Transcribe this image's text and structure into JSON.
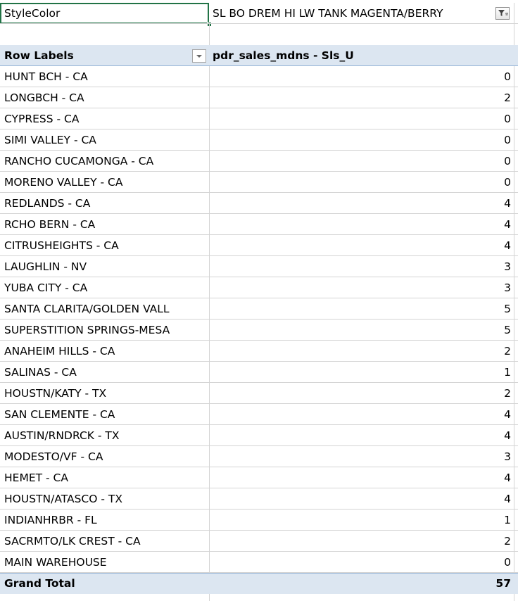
{
  "filter": {
    "label": "StyleColor",
    "value": "SL BO DREM HI LW TANK MAGENTA/BERRY",
    "filter_icon": "filter-active-icon"
  },
  "header": {
    "row_labels": "Row Labels",
    "value_field": "pdr_sales_mdns - Sls_U",
    "dropdown_icon": "dropdown-arrow-icon"
  },
  "rows": [
    {
      "label": "HUNT BCH - CA",
      "value": "0"
    },
    {
      "label": "LONGBCH - CA",
      "value": "2"
    },
    {
      "label": "CYPRESS - CA",
      "value": "0"
    },
    {
      "label": "SIMI VALLEY - CA",
      "value": "0"
    },
    {
      "label": "RANCHO CUCAMONGA - CA",
      "value": "0"
    },
    {
      "label": "MORENO VALLEY - CA",
      "value": "0"
    },
    {
      "label": "REDLANDS - CA",
      "value": "4"
    },
    {
      "label": "RCHO BERN - CA",
      "value": "4"
    },
    {
      "label": "CITRUSHEIGHTS - CA",
      "value": "4"
    },
    {
      "label": "LAUGHLIN - NV",
      "value": "3"
    },
    {
      "label": "YUBA CITY - CA",
      "value": "3"
    },
    {
      "label": "SANTA CLARITA/GOLDEN VALL",
      "value": "5"
    },
    {
      "label": "SUPERSTITION SPRINGS-MESA",
      "value": "5"
    },
    {
      "label": "ANAHEIM HILLS - CA",
      "value": "2"
    },
    {
      "label": "SALINAS - CA",
      "value": "1"
    },
    {
      "label": "HOUSTN/KATY - TX",
      "value": "2"
    },
    {
      "label": "SAN CLEMENTE - CA",
      "value": "4"
    },
    {
      "label": "AUSTIN/RNDRCK - TX",
      "value": "4"
    },
    {
      "label": "MODESTO/VF - CA",
      "value": "3"
    },
    {
      "label": "HEMET - CA",
      "value": "4"
    },
    {
      "label": "HOUSTN/ATASCO - TX",
      "value": "4"
    },
    {
      "label": "INDIANHRBR - FL",
      "value": "1"
    },
    {
      "label": "SACRMTO/LK CREST - CA",
      "value": "2"
    },
    {
      "label": "MAIN WAREHOUSE",
      "value": "0"
    }
  ],
  "total": {
    "label": "Grand Total",
    "value": "57"
  },
  "colors": {
    "header_fill": "#dce6f1",
    "header_border": "#95b3d7",
    "selection": "#217346",
    "gridline": "#d4d4d4"
  }
}
